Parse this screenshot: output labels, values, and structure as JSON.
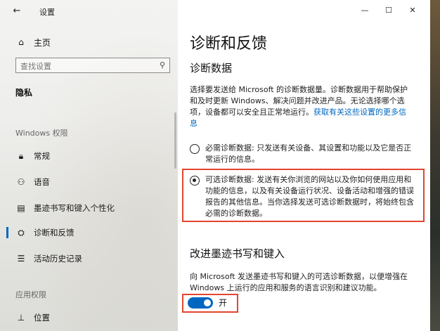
{
  "window": {
    "title": "设置",
    "back_icon": "back-arrow-icon",
    "controls": [
      "—",
      "☐",
      "✕"
    ]
  },
  "sidebar": {
    "home_label": "主页",
    "search_placeholder": "查找设置",
    "section_title": "隐私",
    "groups": [
      {
        "label": "Windows 权限",
        "items": [
          {
            "label": "常规",
            "icon": "lock-icon",
            "glyph": "🔒"
          },
          {
            "label": "语音",
            "icon": "voice-icon",
            "glyph": "⚇"
          },
          {
            "label": "墨迹书写和键入个性化",
            "icon": "pen-icon",
            "glyph": "▤"
          },
          {
            "label": "诊断和反馈",
            "icon": "feedback-icon",
            "glyph": "⛭",
            "active": true
          },
          {
            "label": "活动历史记录",
            "icon": "history-icon",
            "glyph": "☰"
          }
        ]
      },
      {
        "label": "应用权限",
        "items": [
          {
            "label": "位置",
            "icon": "location-icon",
            "glyph": "⊥"
          }
        ]
      }
    ],
    "accent_color": "#0067c0"
  },
  "main": {
    "title": "诊断和反馈",
    "diag_heading": "诊断数据",
    "diag_desc": "选择要发送给 Microsoft 的诊断数据量。诊断数据用于帮助保护和及时更新 Windows、解决问题并改进产品。无论选择哪个选项，设备都可以安全且正常地运行。",
    "diag_link": "获取有关这些设置的更多信息",
    "option_required": "必需诊断数据: 只发送有关设备、其设置和功能以及它是否正常运行的信息。",
    "option_optional": "可选诊断数据: 发送有关你浏览的网站以及你如何使用应用和功能的信息，以及有关设备运行状况、设备活动和增强的错误报告的其他信息。当你选择发送可选诊断数据时，将始终包含必需的诊断数据。",
    "ink_heading": "改进墨迹书写和键入",
    "ink_desc": "向 Microsoft 发送墨迹书写和键入的可选诊断数据，以便增强在 Windows 上运行的应用和服务的语言识别和建议功能。",
    "toggle_state": "开",
    "highlight_color": "#e2452f"
  }
}
